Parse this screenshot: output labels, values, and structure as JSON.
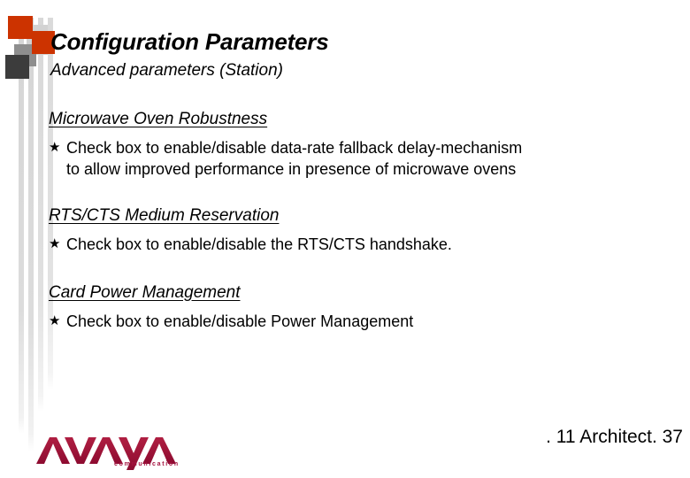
{
  "slide": {
    "title": "Configuration Parameters",
    "subtitle": "Advanced parameters (Station)"
  },
  "bullet_glyph": "★",
  "sections": [
    {
      "heading": "Microwave Oven Robustness",
      "bullets": [
        "Check box to enable/disable data-rate fallback delay-mechanism\nto allow improved performance in presence of microwave ovens"
      ]
    },
    {
      "heading": "RTS/CTS Medium Reservation",
      "bullets": [
        "Check box to enable/disable the RTS/CTS handshake."
      ]
    },
    {
      "heading": "Card Power Management",
      "bullets": [
        "Check box to enable/disable Power Management"
      ]
    }
  ],
  "logo": {
    "wordmark": "AVAYA",
    "tagline": "communication",
    "color": "#a4123f"
  },
  "footer": {
    "right_text": ". 11 Architect.  37"
  },
  "colors": {
    "accent_red": "#cc3300",
    "gray_light": "#d2d2d2",
    "gray_mid": "#8e8e8e",
    "gray_dark": "#3c3c3c",
    "rule_gray": "#d9d9d9",
    "background": "#ffffff"
  }
}
